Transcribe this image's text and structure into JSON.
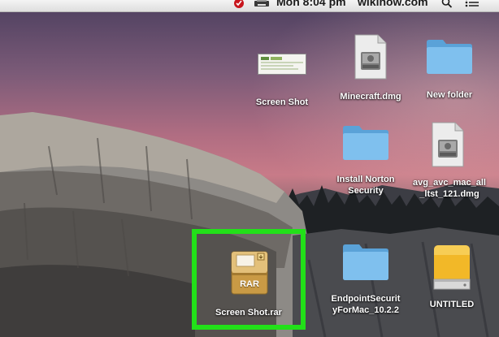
{
  "menubar": {
    "clock": "Mon 8:04 pm",
    "site": "wikihow.com",
    "icons": [
      "norton-icon",
      "printer-icon",
      "spotlight-search-icon",
      "notification-center-icon"
    ]
  },
  "desktop_items": [
    {
      "label": "Screen Shot",
      "icon": "screenshot-thumbnail-icon"
    },
    {
      "label": "Minecraft.dmg",
      "icon": "dmg-disk-image-icon"
    },
    {
      "label": "New folder",
      "icon": "folder-icon"
    },
    {
      "label_lines": [
        "Install Norton",
        "Security"
      ],
      "icon": "folder-icon"
    },
    {
      "label_lines": [
        "avg_avc_mac_all",
        "_ltst_121.dmg"
      ],
      "icon": "dmg-disk-image-icon"
    },
    {
      "label": "Screen Shot.rar",
      "icon": "rar-archive-icon",
      "badge": "RAR",
      "selected": true
    },
    {
      "label_lines": [
        "EndpointSecurit",
        "yForMac_10.2.2"
      ],
      "icon": "folder-icon"
    },
    {
      "label": "UNTITLED",
      "icon": "external-drive-icon"
    }
  ],
  "colors": {
    "highlight": "#22e019",
    "folder": "#6fb4e6",
    "rar": "#d2a54c",
    "drive": "#f2b828"
  }
}
